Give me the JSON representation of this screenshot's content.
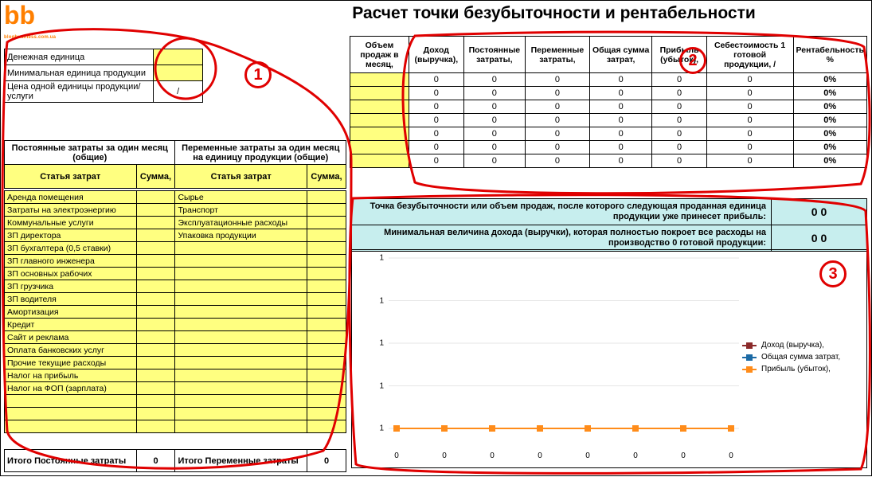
{
  "logo": {
    "big": "bb",
    "small": "blogbusiness.com.ua"
  },
  "title": "Расчет точки безубыточности и рентабельности",
  "params": [
    {
      "label": "Денежная единица",
      "value": ""
    },
    {
      "label": "Минимальная единица продукции",
      "value": ""
    },
    {
      "label": "Цена одной единицы продукции/услуги",
      "value": "/",
      "divstyle": true
    }
  ],
  "cost_headers": {
    "left": "Постоянные затраты за один месяц (общие)",
    "right": "Переменные затраты за один месяц на единицу продукции (общие)",
    "col_item": "Статья затрат",
    "col_sum": "Сумма,"
  },
  "fixed_costs": [
    "Аренда помещения",
    "Затраты на электроэнергию",
    "Коммунальные услуги",
    "ЗП директора",
    "ЗП бухгалтера (0,5 ставки)",
    "ЗП главного инженера",
    "ЗП основных рабочих",
    "ЗП грузчика",
    "ЗП водителя",
    "Амортизация",
    "Кредит",
    "Сайт и реклама",
    "Оплата банковских услуг",
    "Прочие текущие расходы",
    "Налог на прибыль",
    "Налог на ФОП (зарплата)",
    "",
    "",
    ""
  ],
  "variable_costs": [
    "Сырье",
    "Транспорт",
    "Эксплуатационные расходы",
    "Упаковка продукции",
    "",
    "",
    "",
    "",
    "",
    "",
    "",
    "",
    "",
    "",
    "",
    "",
    "",
    "",
    ""
  ],
  "totals": {
    "fixed_label": "Итого Постоянные затраты",
    "fixed_value": "0",
    "variable_label": "Итого Переменные затраты",
    "variable_value": "0"
  },
  "results": {
    "headers": [
      "Объем продаж в месяц,",
      "Доход (выручка),",
      "Постоянные затраты,",
      "Переменные затраты,",
      "Общая сумма затрат,",
      "Прибыль (убыток),",
      "Себестоимость 1 готовой продукции, /",
      "Рентабельность %"
    ],
    "rows": [
      [
        "",
        "0",
        "0",
        "0",
        "0",
        "0",
        "0",
        "0%"
      ],
      [
        "",
        "0",
        "0",
        "0",
        "0",
        "0",
        "0",
        "0%"
      ],
      [
        "",
        "0",
        "0",
        "0",
        "0",
        "0",
        "0",
        "0%"
      ],
      [
        "",
        "0",
        "0",
        "0",
        "0",
        "0",
        "0",
        "0%"
      ],
      [
        "",
        "0",
        "0",
        "0",
        "0",
        "0",
        "0",
        "0%"
      ],
      [
        "",
        "0",
        "0",
        "0",
        "0",
        "0",
        "0",
        "0%"
      ],
      [
        "",
        "0",
        "0",
        "0",
        "0",
        "0",
        "0",
        "0%"
      ]
    ]
  },
  "breakeven": {
    "row1_label": "Точка безубыточности или объем продаж, после которого следующая проданная единица продукции уже принесет прибыль:",
    "row1_value": "0 0",
    "row2_label": "Минимальная величина дохода (выручки), которая полностью покроет все расходы на производство 0  готовой продукции:",
    "row2_value": "0 0"
  },
  "chart_data": {
    "type": "line",
    "title": "",
    "xlabel": "",
    "ylabel": "",
    "x": [
      0,
      0,
      0,
      0,
      0,
      0,
      0,
      0
    ],
    "y_ticks": [
      1,
      1,
      1,
      1,
      1
    ],
    "series": [
      {
        "name": "Доход (выручка),",
        "color": "#8b2a2a",
        "marker": "square",
        "values": [
          0,
          0,
          0,
          0,
          0,
          0,
          0,
          0
        ]
      },
      {
        "name": "Общая сумма затрат,",
        "color": "#1b6aa5",
        "marker": "star",
        "values": [
          0,
          0,
          0,
          0,
          0,
          0,
          0,
          0
        ]
      },
      {
        "name": "Прибыль (убыток),",
        "color": "#ff8c1a",
        "marker": "square",
        "values": [
          0,
          0,
          0,
          0,
          0,
          0,
          0,
          0
        ]
      }
    ]
  },
  "annotations": {
    "1": "1",
    "2": "2",
    "3": "3"
  }
}
